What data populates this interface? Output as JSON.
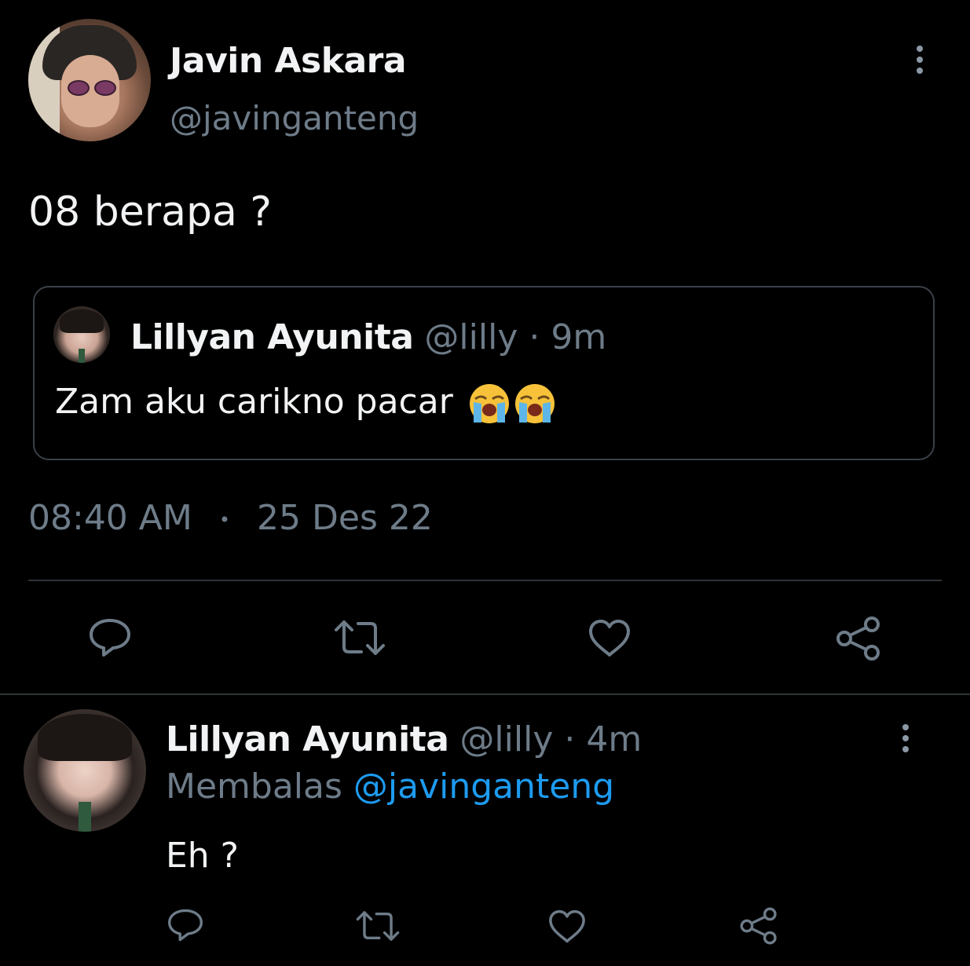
{
  "tweet": {
    "author_name": "Javin Askara",
    "author_handle": "@javinganteng",
    "text": "08 berapa ?",
    "time": "08:40 AM",
    "separator": "•",
    "date": "25 Des 22"
  },
  "quoted": {
    "author_name": "Lillyan Ayunita",
    "author_handle": "@lilly",
    "dot": "·",
    "age": "9m",
    "text": "Zam aku carikno pacar",
    "emojis": [
      "loudly-crying-face",
      "loudly-crying-face"
    ]
  },
  "reply": {
    "author_name": "Lillyan Ayunita",
    "author_handle": "@lilly",
    "dot": "·",
    "age": "4m",
    "replying_prefix": "Membalas",
    "replying_to": "@javinganteng",
    "text": "Eh ?"
  },
  "colors": {
    "background": "#000000",
    "text": "#e7e9ea",
    "muted": "#6e7c89",
    "link": "#1d9bf0",
    "divider": "#2f3336"
  },
  "icons": [
    "reply-icon",
    "retweet-icon",
    "like-icon",
    "share-icon",
    "more-icon"
  ]
}
